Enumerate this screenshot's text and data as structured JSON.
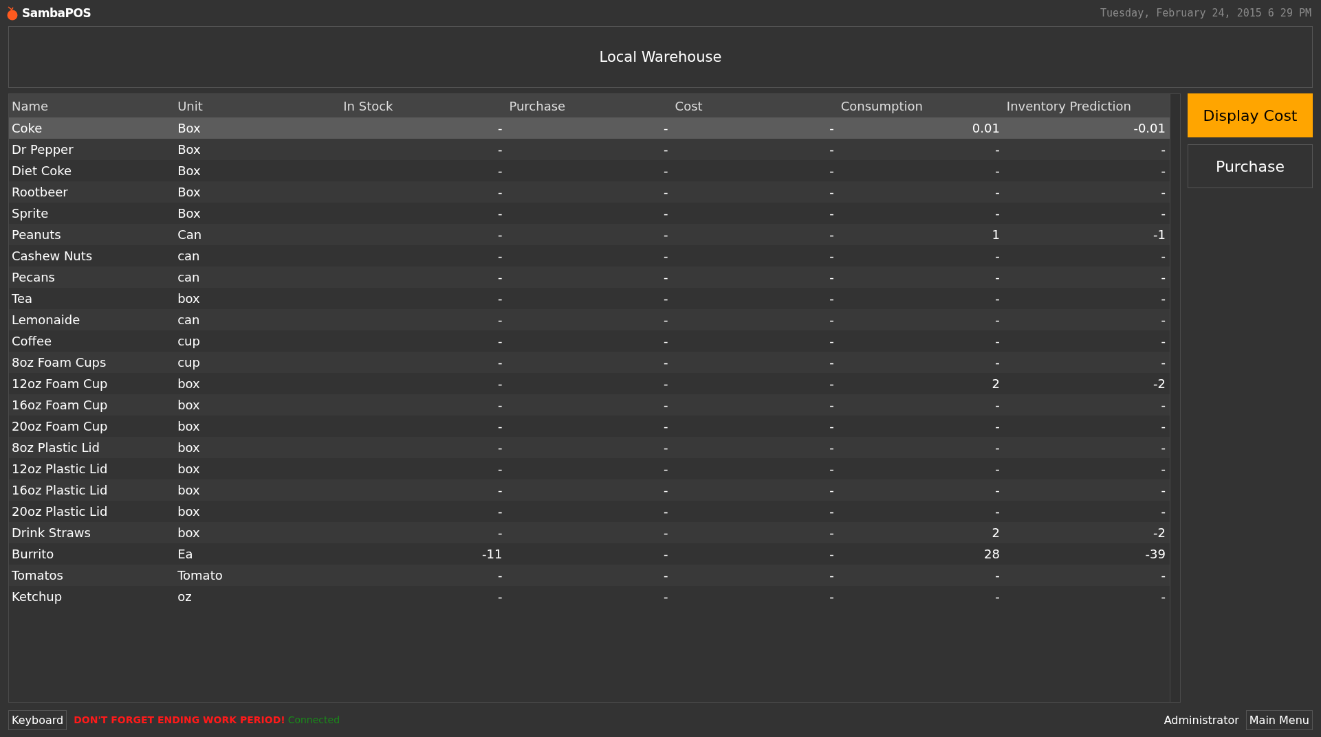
{
  "app": {
    "name": "SambaPOS",
    "datetime": "Tuesday, February 24, 2015 6 29 PM"
  },
  "header": {
    "title": "Local Warehouse"
  },
  "table": {
    "columns": [
      "Name",
      "Unit",
      "In Stock",
      "Purchase",
      "Cost",
      "Consumption",
      "Inventory Prediction"
    ],
    "rows": [
      {
        "name": "Coke",
        "unit": "Box",
        "values": [
          "-",
          "-",
          "-",
          "0.01",
          "-0.01"
        ],
        "selected": true
      },
      {
        "name": "Dr Pepper",
        "unit": "Box",
        "values": [
          "-",
          "-",
          "-",
          "-",
          "-"
        ],
        "selected": false
      },
      {
        "name": "Diet Coke",
        "unit": "Box",
        "values": [
          "-",
          "-",
          "-",
          "-",
          "-"
        ],
        "selected": false
      },
      {
        "name": "Rootbeer",
        "unit": "Box",
        "values": [
          "-",
          "-",
          "-",
          "-",
          "-"
        ],
        "selected": false
      },
      {
        "name": "Sprite",
        "unit": "Box",
        "values": [
          "-",
          "-",
          "-",
          "-",
          "-"
        ],
        "selected": false
      },
      {
        "name": "Peanuts",
        "unit": "Can",
        "values": [
          "-",
          "-",
          "-",
          "1",
          "-1"
        ],
        "selected": false
      },
      {
        "name": "Cashew Nuts",
        "unit": "can",
        "values": [
          "-",
          "-",
          "-",
          "-",
          "-"
        ],
        "selected": false
      },
      {
        "name": "Pecans",
        "unit": "can",
        "values": [
          "-",
          "-",
          "-",
          "-",
          "-"
        ],
        "selected": false
      },
      {
        "name": "Tea",
        "unit": "box",
        "values": [
          "-",
          "-",
          "-",
          "-",
          "-"
        ],
        "selected": false
      },
      {
        "name": "Lemonaide",
        "unit": "can",
        "values": [
          "-",
          "-",
          "-",
          "-",
          "-"
        ],
        "selected": false
      },
      {
        "name": "Coffee",
        "unit": "cup",
        "values": [
          "-",
          "-",
          "-",
          "-",
          "-"
        ],
        "selected": false
      },
      {
        "name": "8oz Foam Cups",
        "unit": "cup",
        "values": [
          "-",
          "-",
          "-",
          "-",
          "-"
        ],
        "selected": false
      },
      {
        "name": "12oz Foam Cup",
        "unit": "box",
        "values": [
          "-",
          "-",
          "-",
          "2",
          "-2"
        ],
        "selected": false
      },
      {
        "name": "16oz Foam Cup",
        "unit": "box",
        "values": [
          "-",
          "-",
          "-",
          "-",
          "-"
        ],
        "selected": false
      },
      {
        "name": "20oz Foam Cup",
        "unit": "box",
        "values": [
          "-",
          "-",
          "-",
          "-",
          "-"
        ],
        "selected": false
      },
      {
        "name": "8oz Plastic Lid",
        "unit": "box",
        "values": [
          "-",
          "-",
          "-",
          "-",
          "-"
        ],
        "selected": false
      },
      {
        "name": "12oz Plastic Lid",
        "unit": "box",
        "values": [
          "-",
          "-",
          "-",
          "-",
          "-"
        ],
        "selected": false
      },
      {
        "name": "16oz Plastic Lid",
        "unit": "box",
        "values": [
          "-",
          "-",
          "-",
          "-",
          "-"
        ],
        "selected": false
      },
      {
        "name": "20oz Plastic Lid",
        "unit": "box",
        "values": [
          "-",
          "-",
          "-",
          "-",
          "-"
        ],
        "selected": false
      },
      {
        "name": "Drink Straws",
        "unit": "box",
        "values": [
          "-",
          "-",
          "-",
          "2",
          "-2"
        ],
        "selected": false
      },
      {
        "name": "Burrito",
        "unit": "Ea",
        "values": [
          "-11",
          "-",
          "-",
          "28",
          "-39"
        ],
        "selected": false
      },
      {
        "name": "Tomatos",
        "unit": "Tomato",
        "values": [
          "-",
          "-",
          "-",
          "-",
          "-"
        ],
        "selected": false
      },
      {
        "name": "Ketchup",
        "unit": "oz",
        "values": [
          "-",
          "-",
          "-",
          "-",
          "-"
        ],
        "selected": false
      }
    ]
  },
  "actions": [
    {
      "label": "Display Cost",
      "kind": "primary"
    },
    {
      "label": "Purchase",
      "kind": "normal"
    }
  ],
  "status_bar": {
    "keyboard": "Keyboard",
    "warning": "DON'T FORGET ENDING WORK PERIOD!",
    "connection": "Connected",
    "user": "Administrator",
    "menu": "Main Menu"
  }
}
